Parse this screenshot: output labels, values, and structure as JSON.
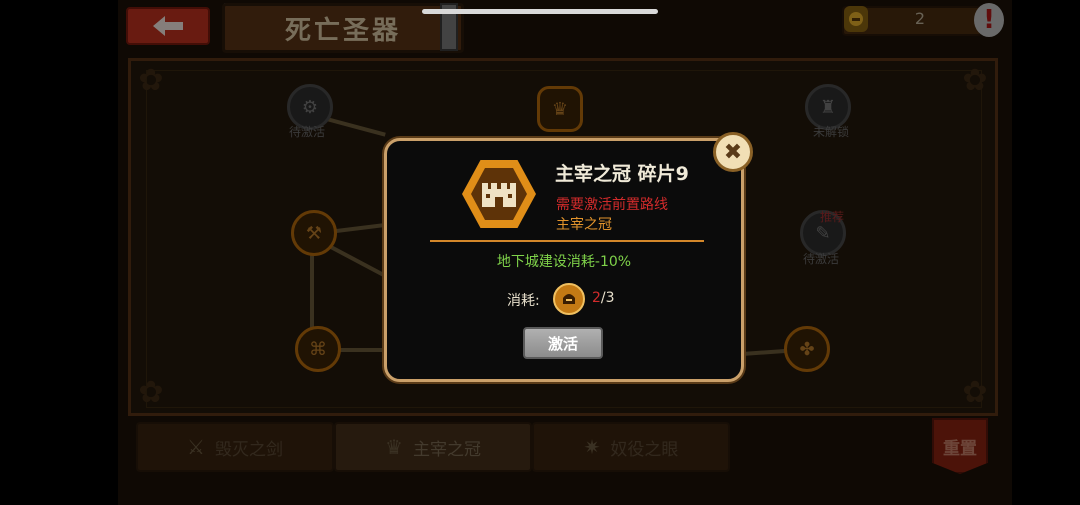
{
  "header": {
    "title": "死亡圣器",
    "back_icon": "arrow-left-icon",
    "resource_count": "2",
    "alert_symbol": "!"
  },
  "board": {
    "nodes": [
      {
        "label": "待激活"
      },
      {
        "label": "未解锁"
      },
      {
        "label": "待激活"
      },
      {
        "label": "推荐"
      }
    ]
  },
  "tabs": [
    {
      "label": "毁灭之剑",
      "icon": "sword-icon"
    },
    {
      "label": "主宰之冠",
      "icon": "crown-icon"
    },
    {
      "label": "奴役之眼",
      "icon": "eye-icon"
    }
  ],
  "reset_label": "重置",
  "dialog": {
    "title": "主宰之冠 碎片9",
    "requirement": "需要激活前置路线",
    "route": "主宰之冠",
    "effect": "地下城建设消耗-10%",
    "cost_label": "消耗:",
    "cost_have": "2",
    "cost_sep": "/",
    "cost_need": "3",
    "activate_label": "激活",
    "close_symbol": "✖"
  },
  "colors": {
    "accent_orange": "#e08e18",
    "warning_red": "#d22b2b",
    "effect_green": "#7fd24a",
    "dialog_border": "#caa06a"
  }
}
